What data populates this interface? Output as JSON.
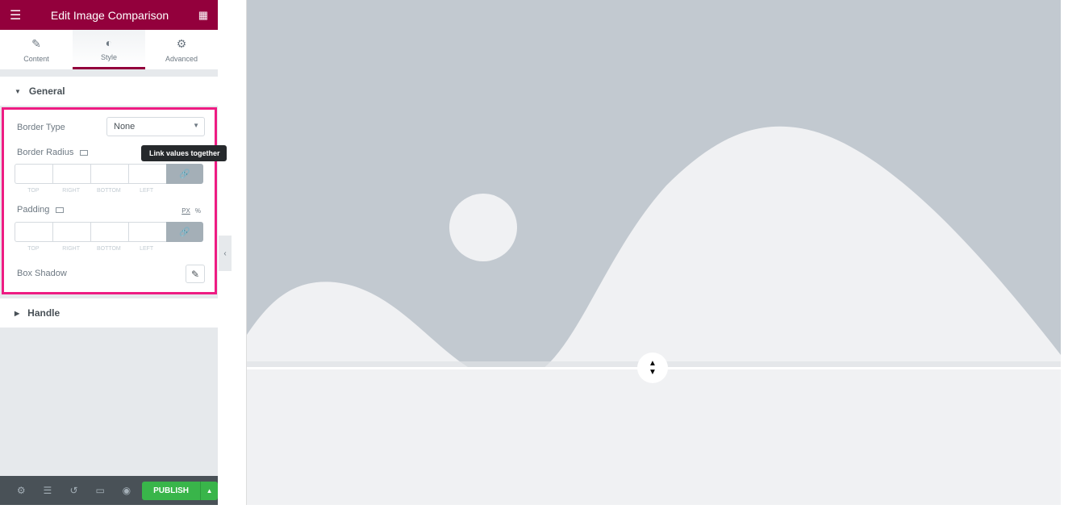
{
  "header": {
    "title": "Edit Image Comparison",
    "menu_icon": "hamburger-icon",
    "apps_icon": "grid-icon"
  },
  "tabs": [
    {
      "label": "Content",
      "icon": "pencil-icon"
    },
    {
      "label": "Style",
      "icon": "contrast-icon",
      "active": true
    },
    {
      "label": "Advanced",
      "icon": "gear-icon"
    }
  ],
  "sections": {
    "general": "General",
    "handle": "Handle"
  },
  "general": {
    "border_type_label": "Border Type",
    "border_type_value": "None",
    "border_radius_label": "Border Radius",
    "link_tooltip": "Link values together",
    "dim_labels": [
      "TOP",
      "RIGHT",
      "BOTTOM",
      "LEFT"
    ],
    "padding_label": "Padding",
    "unit_px": "PX",
    "unit_pct": "%",
    "box_shadow_label": "Box Shadow"
  },
  "footer": {
    "publish_label": "PUBLISH"
  },
  "colors": {
    "brand": "#93003c",
    "highlight": "#ee1c83",
    "publish": "#39b54a",
    "image_bg": "#c2c9d0",
    "image_fg": "#f0f1f3"
  }
}
